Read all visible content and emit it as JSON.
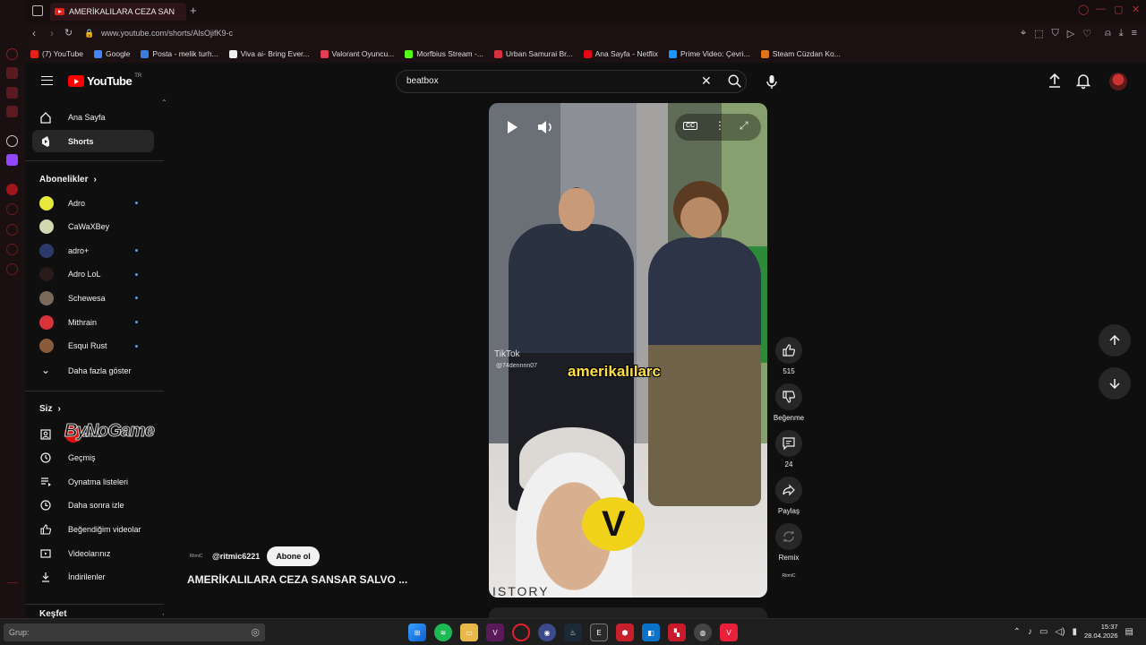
{
  "browser": {
    "tab_title": "AMERİKALILARA CEZA SAN",
    "url": "www.youtube.com/shorts/AlsOjifK9-c",
    "bookmarks": [
      {
        "label": "(7) YouTube",
        "color": "#e62117"
      },
      {
        "label": "Google",
        "color": "#4285f4"
      },
      {
        "label": "Posta - melik turh...",
        "color": "#3b7ddd"
      },
      {
        "label": "Viva ai- Bring Ever...",
        "color": "#eeeeee"
      },
      {
        "label": "Valorant Oyuncu...",
        "color": "#e33d53"
      },
      {
        "label": "Morfbius Stream -...",
        "color": "#53fc18"
      },
      {
        "label": "Urban Samurai Br...",
        "color": "#d93040"
      },
      {
        "label": "Ana Sayfa - Netflix",
        "color": "#e50914"
      },
      {
        "label": "Prime Video: Çevri...",
        "color": "#1a98ff"
      },
      {
        "label": "Steam Cüzdan Ko...",
        "color": "#e0741a"
      }
    ]
  },
  "header": {
    "logo_text": "YouTube",
    "logo_tr": "TR",
    "search_value": "beatbox"
  },
  "sidebar": {
    "main_items": [
      {
        "label": "Ana Sayfa",
        "icon": "home-icon"
      },
      {
        "label": "Shorts",
        "icon": "shorts-icon",
        "active": true
      }
    ],
    "subscriptions_heading": "Abonelikler",
    "subscriptions": [
      {
        "label": "Adro",
        "color": "#e8e83a",
        "live": true
      },
      {
        "label": "CaWaXBey",
        "color": "#cfd8b0",
        "live": false
      },
      {
        "label": "adro+",
        "color": "#2a3b6a",
        "live": true
      },
      {
        "label": "Adro LoL",
        "color": "#2a1a1a",
        "live": true
      },
      {
        "label": "Schewesa",
        "color": "#7a6a5a",
        "live": true
      },
      {
        "label": "Mithrain",
        "color": "#d9343a",
        "live": true
      },
      {
        "label": "Esqui Rust",
        "color": "#8a5a3a",
        "live": true
      }
    ],
    "show_more": "Daha fazla göster",
    "you_heading": "Siz",
    "you_items": [
      {
        "label": "Kanalınız",
        "icon": "channel-icon"
      },
      {
        "label": "Geçmiş",
        "icon": "history-icon"
      },
      {
        "label": "Oynatma listeleri",
        "icon": "playlist-icon"
      },
      {
        "label": "Daha sonra izle",
        "icon": "watch-later-icon"
      },
      {
        "label": "Beğendiğim videolar",
        "icon": "liked-icon"
      },
      {
        "label": "Videolarınız",
        "icon": "your-videos-icon"
      },
      {
        "label": "İndirilenler",
        "icon": "download-icon"
      }
    ],
    "explore_heading": "Keşfet",
    "watermark_text": "ByNoGame"
  },
  "short": {
    "caption": "amerikalılarc",
    "tiktok": "TikTok",
    "tiktok_user": "@74dennnn07",
    "cc": "CC",
    "channel_handle": "@ritmic6221",
    "channel_thumb_text": "RitmiC",
    "subscribe_label": "Abone ol",
    "title": "AMERİKALILARA CEZA SANSAR SALVO ...",
    "like_count": "515",
    "dislike_label": "Beğenme",
    "comment_count": "24",
    "share_label": "Paylaş",
    "remix_label": "Remix",
    "bottom_text": "ISTORY"
  },
  "taskbar": {
    "search_placeholder": "Grup:",
    "time": "15:37",
    "date": "28.04.2026"
  },
  "colors": {
    "bg": "#0f0f0f",
    "accent_red": "#ff0000",
    "active_item": "#272727",
    "caption_yellow": "#ffe043"
  }
}
